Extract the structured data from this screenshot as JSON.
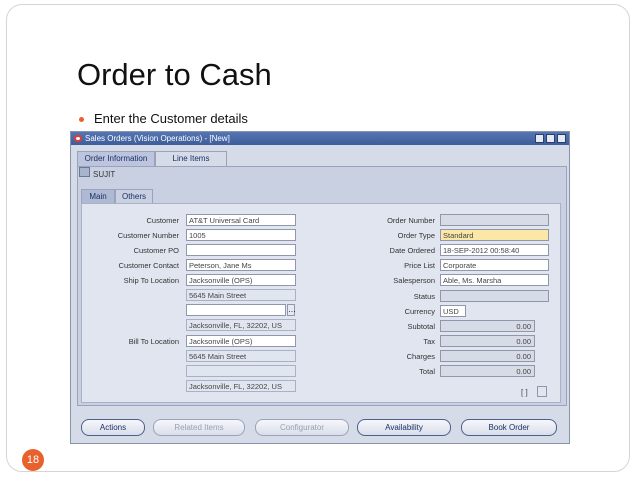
{
  "slide": {
    "title": "Order to Cash",
    "bullet": "Enter the Customer details",
    "page_number": "18"
  },
  "window": {
    "title": "Sales Orders (Vision Operations) - [New]",
    "tabs": [
      "Order Information",
      "Line Items"
    ],
    "user": "SUJIT",
    "subtabs": [
      "Main",
      "Others"
    ]
  },
  "left_fields": {
    "customer": {
      "label": "Customer",
      "value": "AT&T Universal Card"
    },
    "customer_number": {
      "label": "Customer Number",
      "value": "1005"
    },
    "customer_po": {
      "label": "Customer PO",
      "value": ""
    },
    "customer_contact": {
      "label": "Customer Contact",
      "value": "Peterson, Jane Ms"
    },
    "ship_to_location": {
      "label": "Ship To Location",
      "value": "Jacksonville (OPS)"
    },
    "ship_address1": "5645 Main Street",
    "ship_address2": "",
    "ship_address3": "Jacksonville, FL, 32202, US",
    "bill_to_location": {
      "label": "Bill To Location",
      "value": "Jacksonville (OPS)"
    },
    "bill_address1": "5645 Main Street",
    "bill_address2": "",
    "bill_address3": "Jacksonville, FL, 32202, US"
  },
  "right_fields": {
    "order_number": {
      "label": "Order Number",
      "value": ""
    },
    "order_type": {
      "label": "Order Type",
      "value": "Standard"
    },
    "date_ordered": {
      "label": "Date Ordered",
      "value": "18-SEP-2012 00:58:40"
    },
    "price_list": {
      "label": "Price List",
      "value": "Corporate"
    },
    "salesperson": {
      "label": "Salesperson",
      "value": "Able, Ms. Marsha"
    },
    "status": {
      "label": "Status",
      "value": ""
    },
    "currency": {
      "label": "Currency",
      "value": "USD"
    },
    "subtotal": {
      "label": "Subtotal",
      "value": "0.00"
    },
    "tax": {
      "label": "Tax",
      "value": "0.00"
    },
    "charges": {
      "label": "Charges",
      "value": "0.00"
    },
    "total": {
      "label": "Total",
      "value": "0.00"
    },
    "bracket": "[ ]"
  },
  "buttons": {
    "actions": "Actions",
    "related_items": "Related Items",
    "configurator": "Configurator",
    "availability": "Availability",
    "book_order": "Book Order"
  },
  "colors": {
    "accent": "#e8612c",
    "titlebar": "#3e5d9a",
    "required_field": "#fbe8a6"
  }
}
